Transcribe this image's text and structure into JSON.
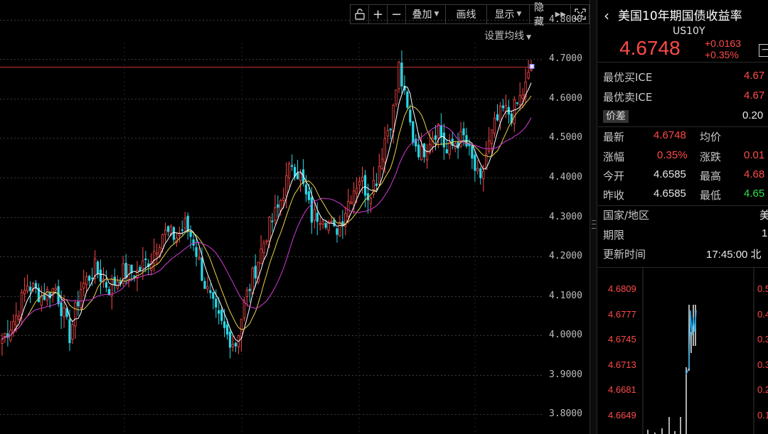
{
  "toolbar": {
    "lock_icon": "unlock-icon",
    "zoom_in": "+",
    "zoom_out": "−",
    "overlay": "叠加",
    "draw": "画线",
    "display": "显示",
    "hide": "隐藏",
    "fullscreen_icon": "fullscreen-icon"
  },
  "set_ma": "设置均线",
  "axis_labels": [
    "4.8000",
    "4.7000",
    "4.6000",
    "4.5000",
    "4.4000",
    "4.3000",
    "4.2000",
    "4.1000",
    "4.0000",
    "3.9000",
    "3.8000"
  ],
  "quote": {
    "name": "美国10年期国债收益率",
    "code": "US10Y",
    "price": "4.6748",
    "change": "+0.0163",
    "change_pct": "+0.35%",
    "best_bid_label": "最优买ICE",
    "best_bid_value": "4.67",
    "best_ask_label": "最优卖ICE",
    "best_ask_value": "4.67",
    "spread_label": "价差",
    "spread_value": "0.20",
    "latest_label": "最新",
    "latest_value": "4.6748",
    "avg_label": "均价",
    "chg_pct_label": "涨幅",
    "chg_pct_value": "0.35%",
    "chg_label": "涨跌",
    "chg_value": "0.01",
    "open_label": "今开",
    "open_value": "4.6585",
    "high_label": "最高",
    "high_value": "4.68",
    "prev_close_label": "昨收",
    "prev_close_value": "4.6585",
    "low_label": "最低",
    "low_value": "4.65",
    "country_label": "国家/地区",
    "country_value": "美",
    "term_label": "期限",
    "term_value": "1",
    "update_label": "更新时间",
    "update_value": "17:45:00 北"
  },
  "mini_chart": {
    "left_axis": [
      "4.6809",
      "4.6777",
      "4.6745",
      "4.6713",
      "4.6681",
      "4.6649"
    ],
    "right_axis": [
      "0.5",
      "0.4",
      "0.3",
      "0.3",
      "0.2",
      "0.1"
    ]
  },
  "colors": {
    "up": "#ff4a4a",
    "down": "#29d7e6",
    "ma5": "#ffffff",
    "ma10": "#e8d24a",
    "ma20": "#d63ad6",
    "ref_line": "#c83232"
  },
  "chart_data": {
    "type": "candlestick",
    "y_range": [
      3.75,
      4.85
    ],
    "ref_value": 4.6812,
    "anchors": [
      [
        0,
        3.99
      ],
      [
        5,
        4.05
      ],
      [
        9,
        4.13
      ],
      [
        14,
        4.1
      ],
      [
        19,
        4.12
      ],
      [
        24,
        4.0
      ],
      [
        28,
        4.12
      ],
      [
        33,
        4.17
      ],
      [
        38,
        4.12
      ],
      [
        43,
        4.16
      ],
      [
        48,
        4.16
      ],
      [
        53,
        4.2
      ],
      [
        57,
        4.26
      ],
      [
        62,
        4.25
      ],
      [
        65,
        4.28
      ],
      [
        68,
        4.24
      ],
      [
        72,
        4.13
      ],
      [
        76,
        4.05
      ],
      [
        80,
        4.0
      ],
      [
        83,
        3.98
      ],
      [
        86,
        4.08
      ],
      [
        90,
        4.17
      ],
      [
        94,
        4.26
      ],
      [
        98,
        4.32
      ],
      [
        101,
        4.39
      ],
      [
        103,
        4.44
      ],
      [
        106,
        4.4
      ],
      [
        110,
        4.3
      ],
      [
        114,
        4.31
      ],
      [
        118,
        4.26
      ],
      [
        121,
        4.3
      ],
      [
        124,
        4.36
      ],
      [
        127,
        4.4
      ],
      [
        130,
        4.36
      ],
      [
        133,
        4.4
      ],
      [
        136,
        4.5
      ],
      [
        139,
        4.57
      ],
      [
        141,
        4.68
      ],
      [
        143,
        4.6
      ],
      [
        146,
        4.5
      ],
      [
        149,
        4.46
      ],
      [
        152,
        4.5
      ],
      [
        155,
        4.53
      ],
      [
        158,
        4.46
      ],
      [
        161,
        4.49
      ],
      [
        164,
        4.5
      ],
      [
        167,
        4.44
      ],
      [
        170,
        4.38
      ],
      [
        172,
        4.46
      ],
      [
        175,
        4.53
      ],
      [
        178,
        4.57
      ],
      [
        181,
        4.56
      ],
      [
        184,
        4.6
      ],
      [
        186,
        4.63
      ],
      [
        188,
        4.675
      ]
    ]
  }
}
